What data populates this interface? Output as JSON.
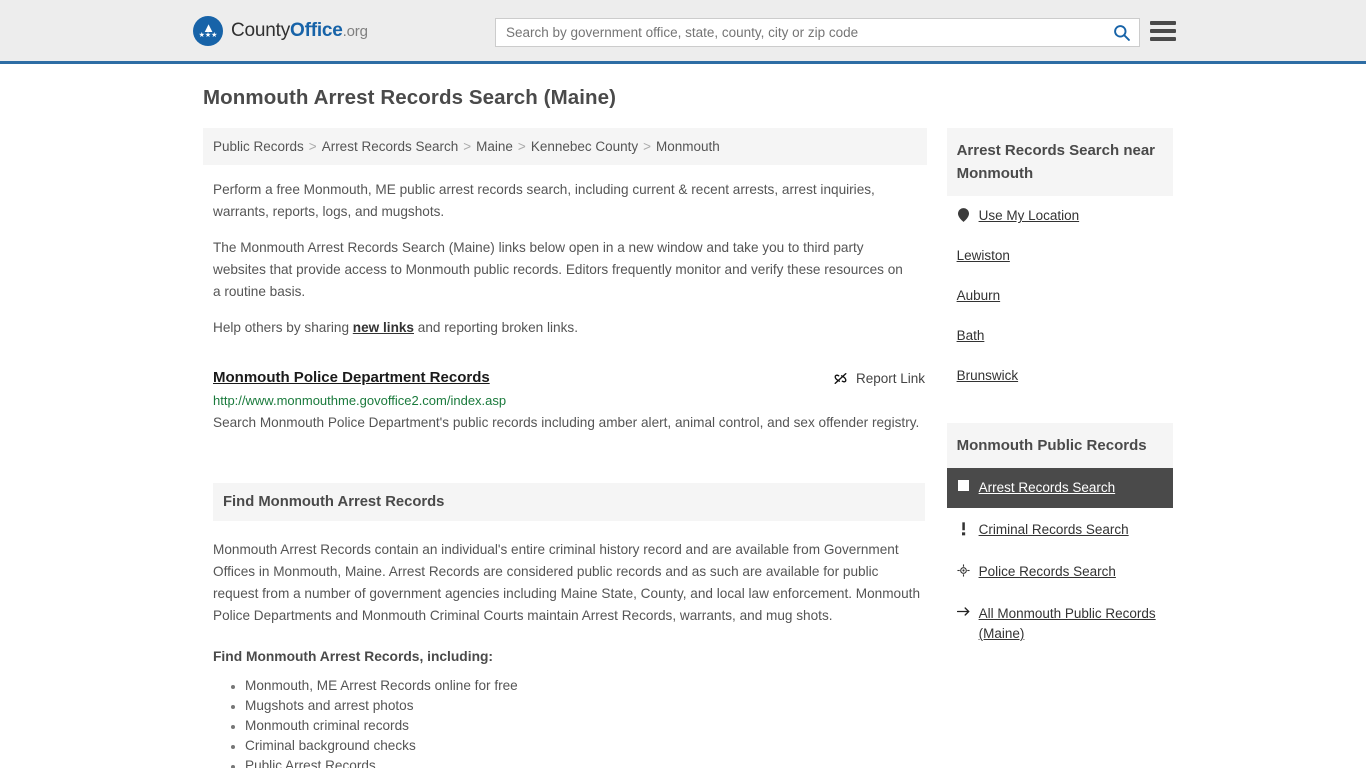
{
  "header": {
    "brand": {
      "part1": "County",
      "part2": "Office",
      "part3": ".org",
      "eagle_glyph": "★"
    },
    "search": {
      "placeholder": "Search by government office, state, county, city or zip code",
      "value": "",
      "button_label": "search-icon"
    },
    "menu_label": "Menu"
  },
  "page": {
    "title": "Monmouth Arrest Records Search (Maine)"
  },
  "breadcrumb": {
    "items": [
      {
        "label": "Public Records"
      },
      {
        "label": "Arrest Records Search"
      },
      {
        "label": "Maine"
      },
      {
        "label": "Kennebec County"
      },
      {
        "label": "Monmouth"
      }
    ],
    "separator": ">"
  },
  "intro": {
    "p1": "Perform a free Monmouth, ME public arrest records search, including current & recent arrests, arrest inquiries, warrants, reports, logs, and mugshots.",
    "p2": "The Monmouth Arrest Records Search (Maine) links below open in a new window and take you to third party websites that provide access to Monmouth public records. Editors frequently monitor and verify these resources on a routine basis.",
    "p3_before": "Help others by sharing ",
    "p3_link": "new links",
    "p3_after": " and reporting broken links."
  },
  "result": {
    "title": "Monmouth Police Department Records",
    "report_label": "Report Link",
    "url": "http://www.monmouthme.govoffice2.com/index.asp",
    "description": "Search Monmouth Police Department's public records including amber alert, animal control, and sex offender registry."
  },
  "find_section": {
    "heading": "Find Monmouth Arrest Records",
    "paragraph": "Monmouth Arrest Records contain an individual's entire criminal history record and are available from Government Offices in Monmouth, Maine. Arrest Records are considered public records and as such are available for public request from a number of government agencies including Maine State, County, and local law enforcement. Monmouth Police Departments and Monmouth Criminal Courts maintain Arrest Records, warrants, and mug shots.",
    "sub_heading": "Find Monmouth Arrest Records, including:",
    "bullets": [
      "Monmouth, ME Arrest Records online for free",
      "Mugshots and arrest photos",
      "Monmouth criminal records",
      "Criminal background checks",
      "Public Arrest Records"
    ]
  },
  "sidebar": {
    "nearby": {
      "heading": "Arrest Records Search near Monmouth",
      "items": [
        {
          "label": "Use My Location",
          "icon": "map-pin-icon"
        },
        {
          "label": "Lewiston",
          "icon": ""
        },
        {
          "label": "Auburn",
          "icon": ""
        },
        {
          "label": "Bath",
          "icon": ""
        },
        {
          "label": "Brunswick",
          "icon": ""
        }
      ]
    },
    "public_records": {
      "heading": "Monmouth Public Records",
      "items": [
        {
          "label": "Arrest Records Search",
          "icon": "white-square-icon",
          "active": true
        },
        {
          "label": "Criminal Records Search",
          "icon": "exclamation-icon",
          "active": false
        },
        {
          "label": "Police Records Search",
          "icon": "badge-target-icon",
          "active": false
        },
        {
          "label": "All Monmouth Public Records (Maine)",
          "icon": "arrow-right-icon",
          "active": false
        }
      ]
    }
  },
  "colors": {
    "brand_blue": "#1763a8",
    "header_bg": "#ededed",
    "header_border": "#2e6da4",
    "panel_bg": "#f5f5f5",
    "active_bg": "#4a4a4a",
    "url_green": "#1a7a3c",
    "text_gray": "#555555"
  }
}
